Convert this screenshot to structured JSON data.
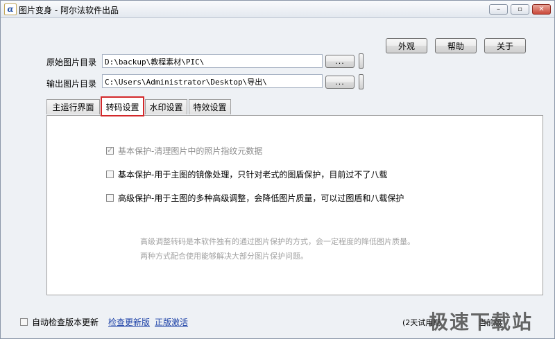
{
  "window": {
    "title": "图片变身 - 阿尔法软件出品",
    "icon_glyph": "α",
    "controls": [
      "–",
      "▫",
      "✕"
    ]
  },
  "toolbar": {
    "appearance_label": "外观",
    "help_label": "帮助",
    "about_label": "关于"
  },
  "paths": {
    "source": {
      "label": "原始图片目录",
      "value": "D:\\backup\\教程素材\\PIC\\",
      "browse_label": "..."
    },
    "output": {
      "label": "输出图片目录",
      "value": "C:\\Users\\Administrator\\Desktop\\导出\\",
      "browse_label": "..."
    }
  },
  "tabs": [
    {
      "label": "主运行界面",
      "active": false
    },
    {
      "label": "转码设置",
      "active": true
    },
    {
      "label": "水印设置",
      "active": false
    },
    {
      "label": "特效设置",
      "active": false
    }
  ],
  "transcode": {
    "options": [
      {
        "label": "基本保护-清理图片中的照片指纹元数据",
        "checked": true,
        "disabled": true
      },
      {
        "label": "基本保护-用于主图的镜像处理，只针对老式的图盾保护，目前过不了八载",
        "checked": false,
        "disabled": false
      },
      {
        "label": "高级保护-用于主图的多种高级调整，会降低图片质量，可以过图盾和八载保护",
        "checked": false,
        "disabled": false
      }
    ],
    "info_lines": [
      "高级调整转码是本软件独有的通过图片保护的方式，会一定程度的降低图片质量。",
      "两种方式配合使用能够解决大部分图片保护问题。"
    ]
  },
  "footer": {
    "auto_update_label": "自动检查版本更新",
    "auto_update_checked": false,
    "check_update_link": "检查更新版",
    "activate_link": "正版激活",
    "status_text": "(2天试用期",
    "status_text_2": "当前版",
    "watermark": "极速下载站"
  },
  "colors": {
    "highlight": "#d3282a",
    "link": "#1a3fa6"
  }
}
